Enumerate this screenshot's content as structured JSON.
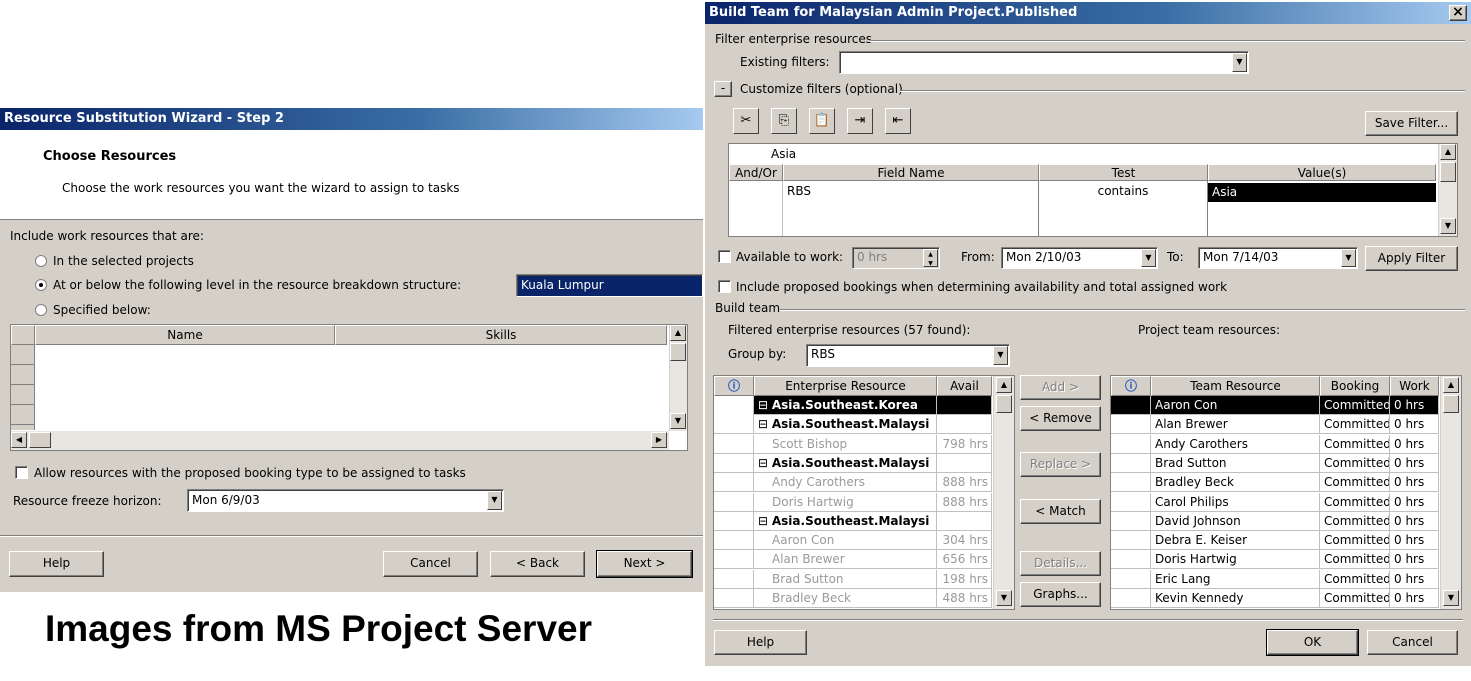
{
  "left_dialog": {
    "title": "Resource Substitution Wizard - Step 2",
    "heading": "Choose Resources",
    "subheading": "Choose the work resources you want the wizard to assign to tasks",
    "include_label": "Include work resources that are:",
    "radio_selected_projects": "In the selected projects",
    "radio_rbs_level": "At or below the following level in the resource breakdown structure:",
    "rbs_value": "Kuala Lumpur",
    "radio_specified": "Specified below:",
    "grid_headers": [
      "Name",
      "Skills"
    ],
    "allow_proposed_label": "Allow resources with the proposed booking type to be assigned to tasks",
    "freeze_label": "Resource freeze horizon:",
    "freeze_value": "Mon 6/9/03",
    "help": "Help",
    "cancel": "Cancel",
    "back": "< Back",
    "next": "Next >"
  },
  "caption": "Images from MS Project Server",
  "right_dialog": {
    "title": "Build Team for Malaysian Admin Project.Published",
    "close": "×",
    "filter_group": "Filter enterprise resources",
    "existing_filters_label": "Existing filters:",
    "existing_filters_value": "",
    "customize_toggle": "-",
    "customize_label": "Customize filters (optional)",
    "save_filter": "Save Filter...",
    "filter_edit_value": "Asia",
    "filter_headers": [
      "And/Or",
      "Field Name",
      "Test",
      "Value(s)"
    ],
    "filter_row": {
      "and_or": "",
      "field": "RBS",
      "test": "contains",
      "value": "Asia"
    },
    "available_label": "Available to work:",
    "available_value": "0 hrs",
    "from_label": "From:",
    "from_value": "Mon 2/10/03",
    "to_label": "To:",
    "to_value": "Mon 7/14/03",
    "apply_filter": "Apply Filter",
    "include_proposed_label": "Include proposed bookings when determining availability and total assigned work",
    "build_team_group": "Build team",
    "filtered_label": "Filtered enterprise resources (57 found):",
    "team_label": "Project team resources:",
    "group_by_label": "Group by:",
    "group_by_value": "RBS",
    "ent_headers": [
      "Enterprise Resource",
      "Avail"
    ],
    "enterprise_rows": [
      {
        "name": "Asia.Southeast.Korea",
        "avail": "",
        "kind": "group",
        "selected": true
      },
      {
        "name": "Asia.Southeast.Malaysi",
        "avail": "",
        "kind": "group",
        "selected": false
      },
      {
        "name": "Scott Bishop",
        "avail": "798 hrs",
        "kind": "item",
        "selected": false
      },
      {
        "name": "Asia.Southeast.Malaysi",
        "avail": "",
        "kind": "group",
        "selected": false
      },
      {
        "name": "Andy Carothers",
        "avail": "888 hrs",
        "kind": "item",
        "selected": false
      },
      {
        "name": "Doris Hartwig",
        "avail": "888 hrs",
        "kind": "item",
        "selected": false
      },
      {
        "name": "Asia.Southeast.Malaysi",
        "avail": "",
        "kind": "group",
        "selected": false
      },
      {
        "name": "Aaron Con",
        "avail": "304 hrs",
        "kind": "item",
        "selected": false
      },
      {
        "name": "Alan Brewer",
        "avail": "656 hrs",
        "kind": "item",
        "selected": false
      },
      {
        "name": "Brad Sutton",
        "avail": "198 hrs",
        "kind": "item",
        "selected": false
      },
      {
        "name": "Bradley Beck",
        "avail": "488 hrs",
        "kind": "item",
        "selected": false
      }
    ],
    "add": "Add >",
    "remove": "< Remove",
    "replace": "Replace >",
    "match": "< Match",
    "details": "Details...",
    "graphs": "Graphs...",
    "team_headers": [
      "Team Resource",
      "Booking",
      "Work"
    ],
    "team_rows": [
      {
        "name": "Aaron Con",
        "booking": "Committed",
        "work": "0 hrs",
        "selected": true
      },
      {
        "name": "Alan Brewer",
        "booking": "Committed",
        "work": "0 hrs",
        "selected": false
      },
      {
        "name": "Andy Carothers",
        "booking": "Committed",
        "work": "0 hrs",
        "selected": false
      },
      {
        "name": "Brad Sutton",
        "booking": "Committed",
        "work": "0 hrs",
        "selected": false
      },
      {
        "name": "Bradley Beck",
        "booking": "Committed",
        "work": "0 hrs",
        "selected": false
      },
      {
        "name": "Carol Philips",
        "booking": "Committed",
        "work": "0 hrs",
        "selected": false
      },
      {
        "name": "David Johnson",
        "booking": "Committed",
        "work": "0 hrs",
        "selected": false
      },
      {
        "name": "Debra E. Keiser",
        "booking": "Committed",
        "work": "0 hrs",
        "selected": false
      },
      {
        "name": "Doris Hartwig",
        "booking": "Committed",
        "work": "0 hrs",
        "selected": false
      },
      {
        "name": "Eric Lang",
        "booking": "Committed",
        "work": "0 hrs",
        "selected": false
      },
      {
        "name": "Kevin Kennedy",
        "booking": "Committed",
        "work": "0 hrs",
        "selected": false
      }
    ],
    "help": "Help",
    "ok": "OK",
    "cancel": "Cancel"
  }
}
